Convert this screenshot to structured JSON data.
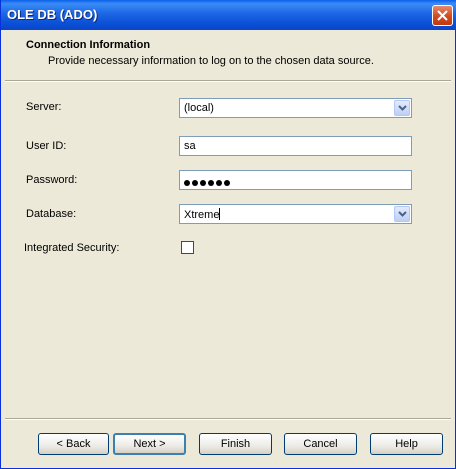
{
  "window": {
    "title": "OLE DB (ADO)"
  },
  "header": {
    "title": "Connection Information",
    "subtitle": "Provide necessary information to log on to the chosen data source."
  },
  "form": {
    "server": {
      "label": "Server:",
      "value": "(local)"
    },
    "user_id": {
      "label": "User ID:",
      "value": "sa"
    },
    "password": {
      "label": "Password:",
      "masked_length": 6
    },
    "database": {
      "label": "Database:",
      "value": "Xtreme"
    },
    "integrated_security": {
      "label": "Integrated Security:",
      "checked": false
    }
  },
  "buttons": {
    "back": "< Back",
    "next": "Next >",
    "finish": "Finish",
    "cancel": "Cancel",
    "help": "Help"
  },
  "icons": {
    "close": "close-icon",
    "dropdown": "chevron-down-icon"
  },
  "colors": {
    "titlebar": "#0a4fd6",
    "background": "#ece9d8",
    "field_border": "#7f9db9"
  }
}
